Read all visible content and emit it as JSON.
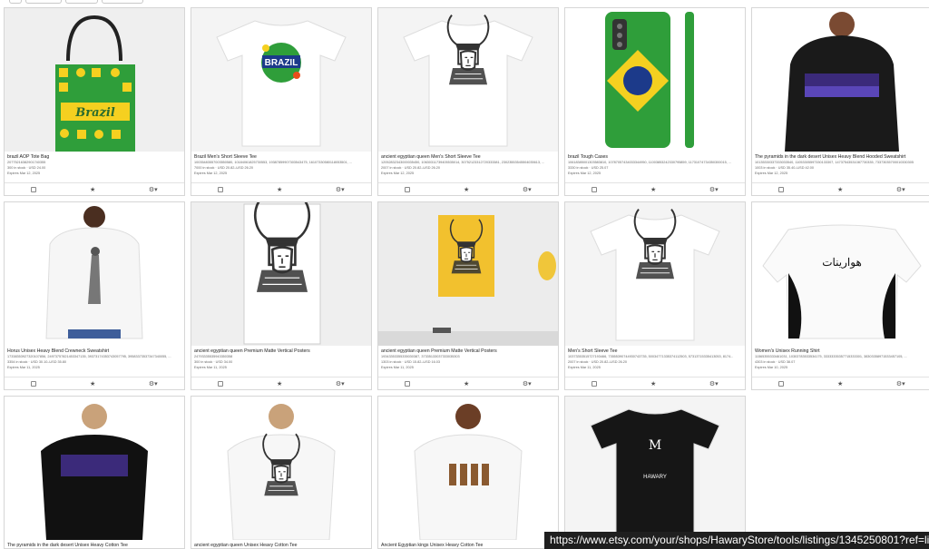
{
  "listings": [
    {
      "title": "brazil AOP Tote Bag",
      "sku": "20775216382901740355",
      "stock": "300 in stock · USD 24.00",
      "expires": "Expires Mar 12, 2025",
      "art": "tote"
    },
    {
      "title": "Brazil Men's Short Sleeve Tee",
      "sku": "10035483557003550580, 10184061825730553, 19387859907303543475, 16107330580118053501, ...",
      "stock": "7000 in stock · USD 20.82–USD 26.20",
      "expires": "Expires Mar 12, 2025",
      "art": "brazil-tee"
    },
    {
      "title": "ancient egyptian queen Men's Short Sleeve Tee",
      "sku": "12052832343000035450, 10630311739405535014, 30752123312720333381, 23023553545504035613, ...",
      "stock": "2007 in stock · USD 20.82–USD 26.20",
      "expires": "Expires Mar 12, 2025",
      "art": "queen-tee"
    },
    {
      "title": "brazil Tough Cases",
      "sku": "10618385001303583810, 10787057434033344950, 11003853242330795859, 11731074734350300015, ...",
      "stock": "3330 in stock · USD 25.07",
      "expires": "Expires Mar 12, 2025",
      "art": "phone"
    },
    {
      "title": "The pyramids in the dark desert Unisex Heavy Blend Hooded Sweatshirt",
      "sku": "10135330337333033540, 11053305597330133307, 14737543531087730335, 73373035700010330305",
      "stock": "1003 in stock · USD 35.40–USD 42.00",
      "expires": "Expires Mar 12, 2025",
      "art": "hoodie"
    },
    {
      "title": "Horus Unisex Heavy Blend Crewneck Sweatshirt",
      "sku": "17338353927320107856, 24973757821453347135, 39373174353743057795, 39583373537347340055, ...",
      "stock": "3354 in stock · USD 30.10–USD 35.80",
      "expires": "Expires Mar 11, 2025",
      "art": "horus"
    },
    {
      "title": "ancient egyptian queen Premium Matte Vertical Posters",
      "sku": "24793335535943350358",
      "stock": "300 in stock · USD 34.00",
      "expires": "Expires Mar 11, 2025",
      "art": "poster"
    },
    {
      "title": "ancient egyptian queen Premium Matte Vertical Posters",
      "sku": "19343353355335030387, 37335133037333035303",
      "stock": "1303 in stock · USD 15.82–USD 16.03",
      "expires": "Expires Mar 11, 2025",
      "art": "poster-room"
    },
    {
      "title": "Men's Short Sleeve Tee",
      "sku": "10373353515727193466, 73555390744930743735, 50034771335374112503, 57313715335413053, 8174...",
      "stock": "2007 in stock · USD 20.82–USD 26.20",
      "expires": "Expires Mar 11, 2025",
      "art": "queen-tee2"
    },
    {
      "title": "Women's Unisex Running Shirt",
      "sku": "11565355333461031, 10303783533534175, 33333335357715333301, 38303358971533457105, ...",
      "stock": "4303 in stock · USD 38.07",
      "expires": "Expires Mar 10, 2025",
      "art": "sport"
    },
    {
      "title": "The pyramids in the dark desert Unisex Heavy Cotton Tee",
      "art": "woman-black"
    },
    {
      "title": "ancient egyptian queen Unisex Heavy Cotton Tee",
      "art": "woman-white"
    },
    {
      "title": "Ancient Egyptian kings Unisex Heavy Cotton Tee",
      "art": "woman-kings"
    },
    {
      "title": "",
      "art": "black-tee"
    }
  ],
  "colors": {
    "brazil_green": "#2f9e3a",
    "brazil_yellow": "#f5d020",
    "brazil_blue": "#1c3a8a",
    "card_border": "#d6d6d6"
  },
  "icons": {
    "select": "checkbox-icon",
    "favorite": "star-icon",
    "settings": "gear-icon"
  },
  "status_url": "https://www.etsy.com/your/shops/HawaryStore/tools/listings/1345250801?ref=li"
}
